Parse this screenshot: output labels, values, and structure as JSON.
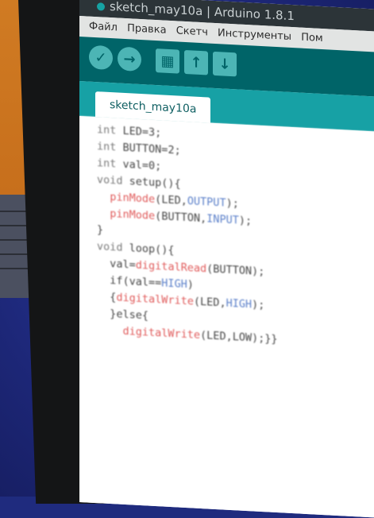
{
  "window": {
    "title": "sketch_may10a | Arduino 1.8.1"
  },
  "menu": [
    "Файл",
    "Правка",
    "Скетч",
    "Инструменты",
    "Пом"
  ],
  "toolbar": {
    "verify_icon": "✓",
    "upload_icon": "→",
    "new_icon": "▦",
    "open_icon": "↑",
    "save_icon": "↓"
  },
  "tab": {
    "label": "sketch_may10a"
  },
  "code": [
    {
      "parts": [
        {
          "t": "int",
          "c": "kw"
        },
        {
          "t": " LED=3;"
        }
      ]
    },
    {
      "parts": [
        {
          "t": "int",
          "c": "kw"
        },
        {
          "t": " BUTTON=2;"
        }
      ]
    },
    {
      "parts": [
        {
          "t": "int",
          "c": "kw"
        },
        {
          "t": " val=0;"
        }
      ]
    },
    {
      "parts": [
        {
          "t": "void",
          "c": "kw"
        },
        {
          "t": " setup(){"
        }
      ]
    },
    {
      "parts": [
        {
          "t": "  "
        },
        {
          "t": "pinMode",
          "c": "fn"
        },
        {
          "t": "(LED,"
        },
        {
          "t": "OUTPUT",
          "c": "const"
        },
        {
          "t": ");"
        }
      ]
    },
    {
      "parts": [
        {
          "t": "  "
        },
        {
          "t": "pinMode",
          "c": "fn"
        },
        {
          "t": "(BUTTON,"
        },
        {
          "t": "INPUT",
          "c": "const"
        },
        {
          "t": ");"
        }
      ]
    },
    {
      "parts": [
        {
          "t": "}"
        }
      ]
    },
    {
      "parts": [
        {
          "t": "void",
          "c": "kw"
        },
        {
          "t": " loop(){"
        }
      ]
    },
    {
      "parts": [
        {
          "t": "  val="
        },
        {
          "t": "digitalRead",
          "c": "fn"
        },
        {
          "t": "(BUTTON);"
        }
      ]
    },
    {
      "parts": [
        {
          "t": "  if(val=="
        },
        {
          "t": "HIGH",
          "c": "const"
        },
        {
          "t": ")"
        }
      ]
    },
    {
      "parts": [
        {
          "t": "  {"
        },
        {
          "t": "digitalWrite",
          "c": "fn"
        },
        {
          "t": "(LED,"
        },
        {
          "t": "HIGH",
          "c": "const"
        },
        {
          "t": ");"
        }
      ]
    },
    {
      "parts": [
        {
          "t": "  }else{"
        }
      ]
    },
    {
      "parts": [
        {
          "t": "    "
        },
        {
          "t": "digitalWrite",
          "c": "fn"
        },
        {
          "t": "(LED,LOW);}}"
        }
      ]
    }
  ]
}
